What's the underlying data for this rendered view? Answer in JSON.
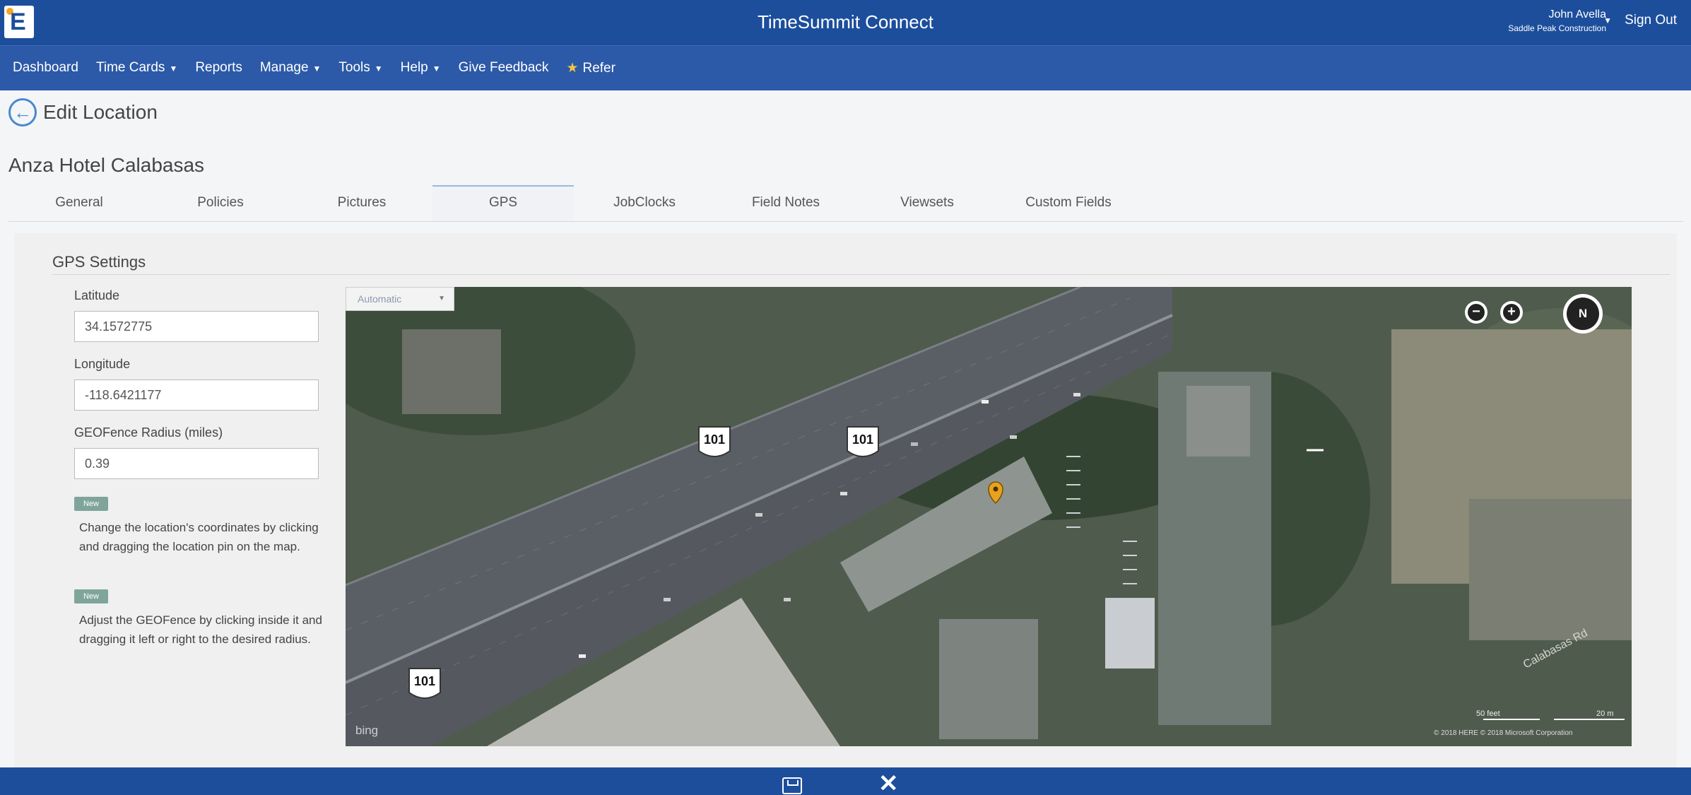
{
  "app": {
    "title": "TimeSummit Connect",
    "user_name": "John Avella",
    "company": "Saddle Peak Construction",
    "sign_out": "Sign Out"
  },
  "nav": {
    "items": [
      "Dashboard",
      "Time Cards",
      "Reports",
      "Manage",
      "Tools",
      "Help",
      "Give Feedback",
      "Refer"
    ]
  },
  "page": {
    "title": "Edit Location",
    "location_name": "Anza Hotel Calabasas"
  },
  "tabs": [
    "General",
    "Policies",
    "Pictures",
    "GPS",
    "JobClocks",
    "Field Notes",
    "Viewsets",
    "Custom Fields"
  ],
  "active_tab": "GPS",
  "gps": {
    "section_title": "GPS Settings",
    "latitude_label": "Latitude",
    "latitude_value": "34.1572775",
    "longitude_label": "Longitude",
    "longitude_value": "-118.6421177",
    "radius_label": "GEOFence Radius (miles)",
    "radius_value": "0.39",
    "new_badge": "New",
    "help_coordinates": "Change the location's coordinates by clicking and dragging the location pin on the map.",
    "help_geofence": "Adjust the GEOFence by clicking inside it and dragging it left or right to the desired radius."
  },
  "map": {
    "mode": "Automatic",
    "highway_shield": "101",
    "compass": "N",
    "provider": "bing",
    "scale_feet": "50 feet",
    "scale_meters": "20 m",
    "copyright": "© 2018 HERE  © 2018 Microsoft Corporation",
    "road_label": "Calabasas Rd",
    "colors": {
      "vegetation": "#3d4d3b",
      "highway": "#5a5f66",
      "pin": "#e9a21f"
    }
  },
  "colors": {
    "brand_blue": "#1c4e9c",
    "nav_blue": "#2c5aa8",
    "accent": "#4a88d0"
  }
}
